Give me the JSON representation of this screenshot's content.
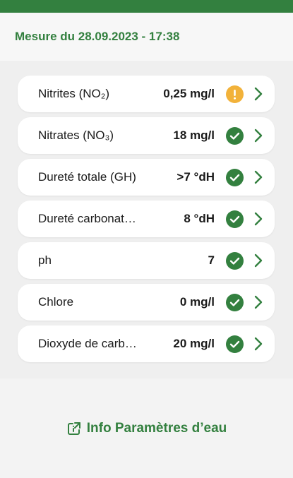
{
  "header": {
    "title": "Mesure du 28.09.2023 - 17:38"
  },
  "parameters": [
    {
      "name": "Nitrites (NO₂)",
      "value": "0,25 mg/l",
      "status": "warning",
      "status_icon": "exclamation-icon"
    },
    {
      "name": "Nitrates (NO₃)",
      "value": "18 mg/l",
      "status": "ok",
      "status_icon": "check-icon"
    },
    {
      "name": "Dureté totale (GH)",
      "value": ">7 °dH",
      "status": "ok",
      "status_icon": "check-icon"
    },
    {
      "name": "Dureté carbonat…",
      "value": "8 °dH",
      "status": "ok",
      "status_icon": "check-icon"
    },
    {
      "name": "ph",
      "value": "7",
      "status": "ok",
      "status_icon": "check-icon"
    },
    {
      "name": "Chlore",
      "value": "0 mg/l",
      "status": "ok",
      "status_icon": "check-icon"
    },
    {
      "name": "Dioxyde de carb…",
      "value": "20 mg/l",
      "status": "ok",
      "status_icon": "check-icon"
    }
  ],
  "info_link": {
    "label": "Info Paramètres d’eau",
    "icon": "external-link-icon"
  },
  "colors": {
    "brand_green": "#33803f",
    "warning_orange": "#f2b23a"
  }
}
